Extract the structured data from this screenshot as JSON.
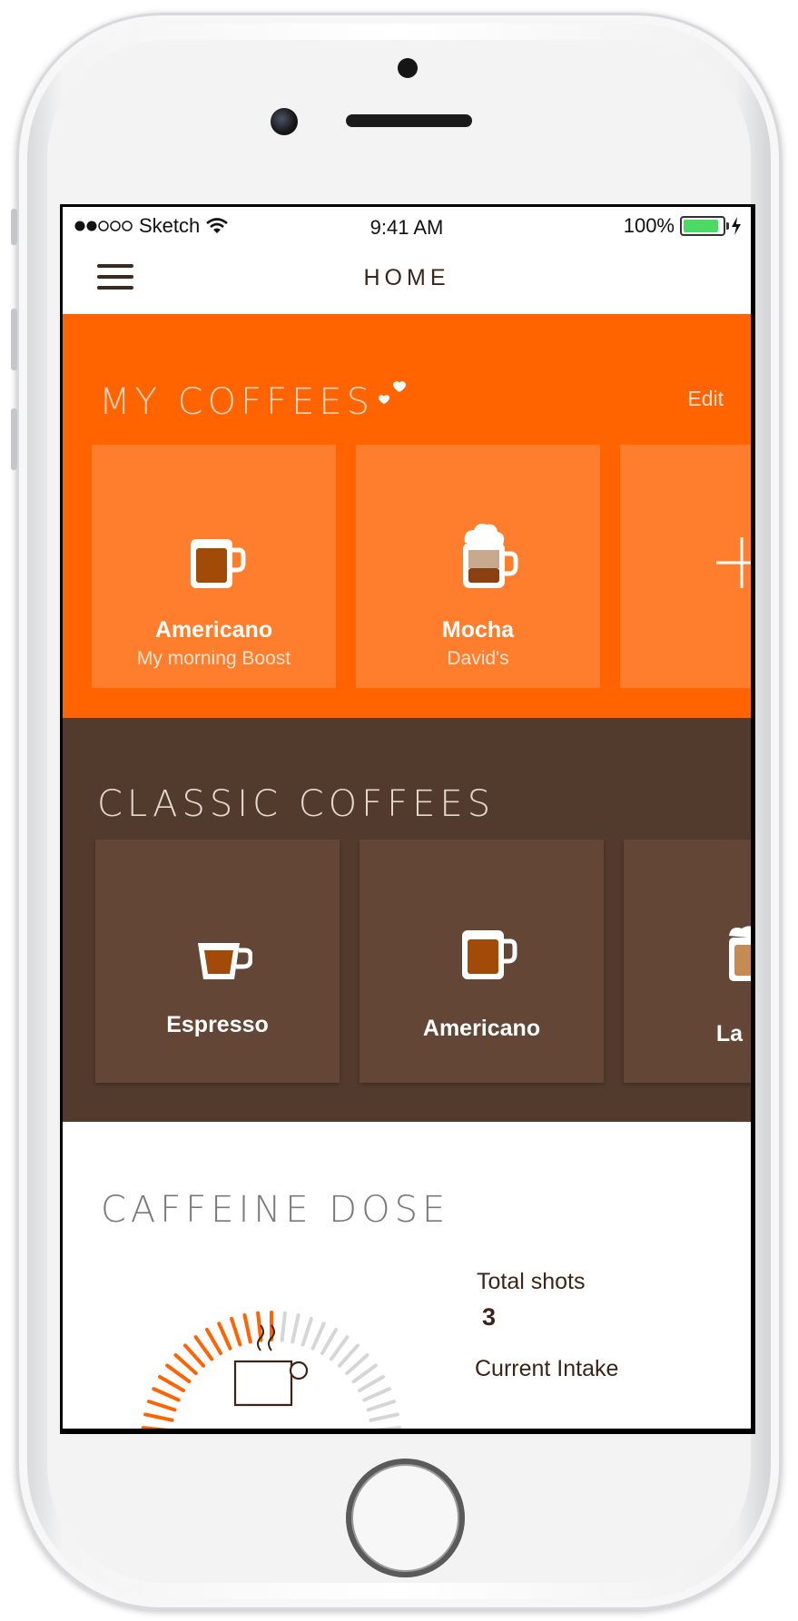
{
  "status_bar": {
    "carrier": "Sketch",
    "time": "9:41 AM",
    "battery": "100%",
    "battery_level": 1.0
  },
  "nav": {
    "title": "HOME",
    "menu_icon": "hamburger-menu-icon"
  },
  "my_coffees": {
    "title": "MY COFFEES",
    "edit_label": "Edit",
    "cards": [
      {
        "name": "Americano",
        "subtitle": "My morning Boost",
        "icon": "mug-icon"
      },
      {
        "name": "Mocha",
        "subtitle": "David's",
        "icon": "mocha-cup-icon"
      },
      {
        "name": "",
        "subtitle": "",
        "icon": "plus-icon"
      }
    ]
  },
  "classic_coffees": {
    "title": "CLASSIC COFFEES",
    "cards": [
      {
        "name": "Espresso",
        "icon": "espresso-cup-icon"
      },
      {
        "name": "Americano",
        "icon": "mug-icon"
      },
      {
        "name": "La",
        "icon": "latte-glass-icon"
      }
    ]
  },
  "caffeine_dose": {
    "title": "CAFFEINE DOSE",
    "total_shots_label": "Total shots",
    "total_shots_value": "3",
    "current_intake_label": "Current Intake",
    "gauge_fill_fraction": 0.5
  },
  "colors": {
    "accent_orange": "#ff6400",
    "card_orange": "#ff7e2d",
    "brown_section": "#523a2c",
    "card_brown": "#634636",
    "dark_text": "#3b2418"
  }
}
